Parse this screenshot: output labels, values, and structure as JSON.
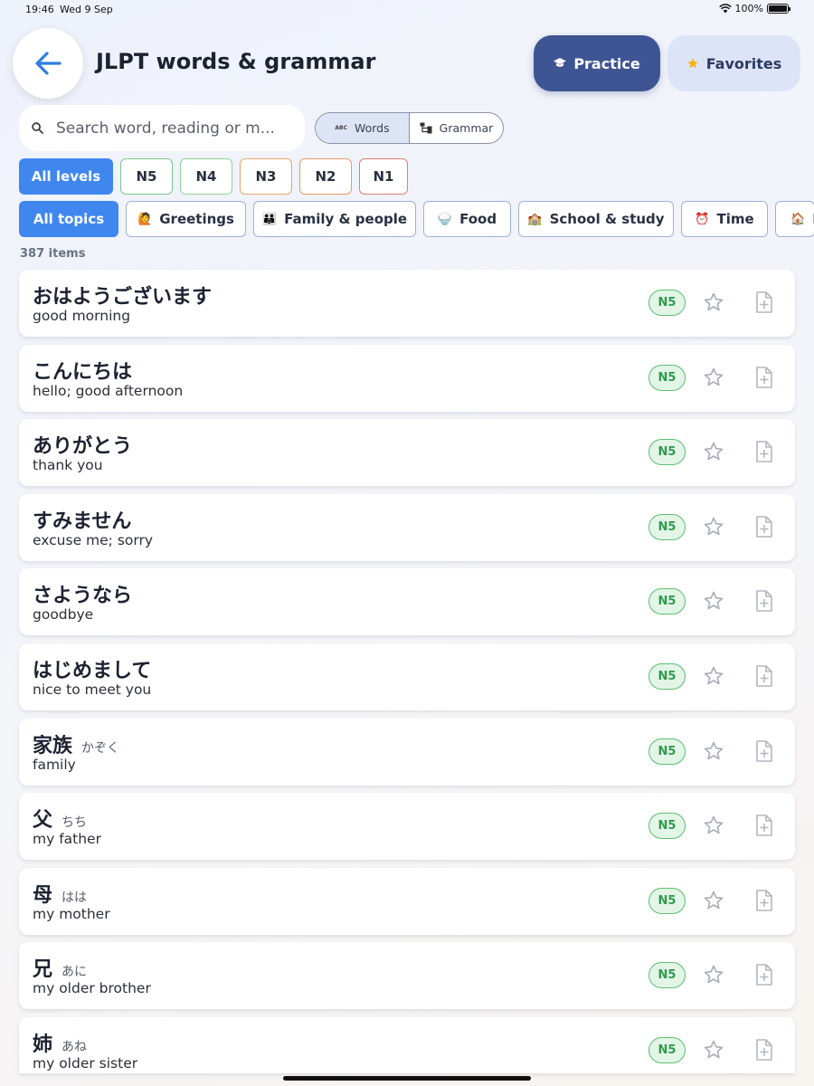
{
  "status_bar": {
    "time": "19:46",
    "date": "Wed 9 Sep",
    "battery": "100%"
  },
  "header": {
    "title": "JLPT words & grammar",
    "practice_label": "Practice",
    "favorites_label": "Favorites"
  },
  "search": {
    "placeholder": "Search word, reading or m..."
  },
  "mode_toggle": {
    "words_label": "Words",
    "grammar_label": "Grammar",
    "words_icon_text": "ABC"
  },
  "levels": [
    "All levels",
    "N5",
    "N4",
    "N3",
    "N2",
    "N1"
  ],
  "topics": [
    {
      "emoji": "🙋",
      "label": "All topics"
    },
    {
      "emoji": "🙋",
      "label": "Greetings"
    },
    {
      "emoji": "👪",
      "label": "Family & people"
    },
    {
      "emoji": "🍚",
      "label": "Food"
    },
    {
      "emoji": "🏫",
      "label": "School & study"
    },
    {
      "emoji": "⏰",
      "label": "Time"
    },
    {
      "emoji": "🏠",
      "label": "D"
    }
  ],
  "item_count": "387 items",
  "words": [
    {
      "jp": "おはようございます",
      "reading": "",
      "meaning": "good morning",
      "level": "N5"
    },
    {
      "jp": "こんにちは",
      "reading": "",
      "meaning": "hello; good afternoon",
      "level": "N5"
    },
    {
      "jp": "ありがとう",
      "reading": "",
      "meaning": "thank you",
      "level": "N5"
    },
    {
      "jp": "すみません",
      "reading": "",
      "meaning": "excuse me; sorry",
      "level": "N5"
    },
    {
      "jp": "さようなら",
      "reading": "",
      "meaning": "goodbye",
      "level": "N5"
    },
    {
      "jp": "はじめまして",
      "reading": "",
      "meaning": "nice to meet you",
      "level": "N5"
    },
    {
      "jp": "家族",
      "reading": "かぞく",
      "meaning": "family",
      "level": "N5"
    },
    {
      "jp": "父",
      "reading": "ちち",
      "meaning": "my father",
      "level": "N5"
    },
    {
      "jp": "母",
      "reading": "はは",
      "meaning": "my mother",
      "level": "N5"
    },
    {
      "jp": "兄",
      "reading": "あに",
      "meaning": "my older brother",
      "level": "N5"
    },
    {
      "jp": "姉",
      "reading": "あね",
      "meaning": "my older sister",
      "level": "N5"
    }
  ],
  "colors": {
    "accent": "#3f87ef",
    "practice": "#3f5593",
    "favorites_bg": "#dde4f7",
    "n5_badge": "#5cbf72"
  }
}
